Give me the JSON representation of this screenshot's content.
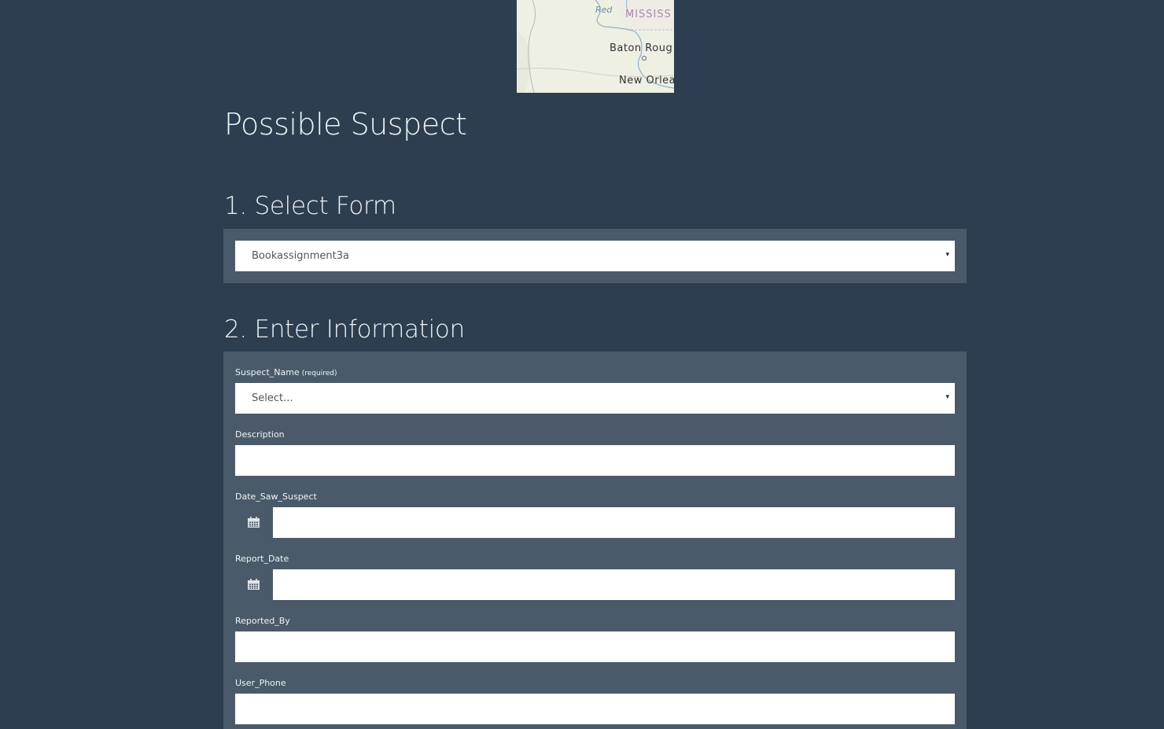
{
  "map": {
    "river_label": "Red",
    "state_label": "MISSISS",
    "city_labels": [
      "Baton Roug",
      "New Orlea"
    ]
  },
  "page": {
    "title": "Possible Suspect"
  },
  "section1": {
    "title": "1. Select Form",
    "form_select_value": "Bookassignment3a",
    "arrow": "▾"
  },
  "section2": {
    "title": "2. Enter Information",
    "fields": {
      "suspect_name": {
        "label": "Suspect_Name",
        "required_note": "(required)",
        "value": "Select..."
      },
      "description": {
        "label": "Description",
        "value": ""
      },
      "date_saw_suspect": {
        "label": "Date_Saw_Suspect",
        "value": ""
      },
      "report_date": {
        "label": "Report_Date",
        "value": ""
      },
      "reported_by": {
        "label": "Reported_By",
        "value": ""
      },
      "user_phone": {
        "label": "User_Phone",
        "value": ""
      }
    }
  },
  "icons": {
    "calendar": "calendar-icon",
    "dropdown": "chevron-down-icon"
  }
}
